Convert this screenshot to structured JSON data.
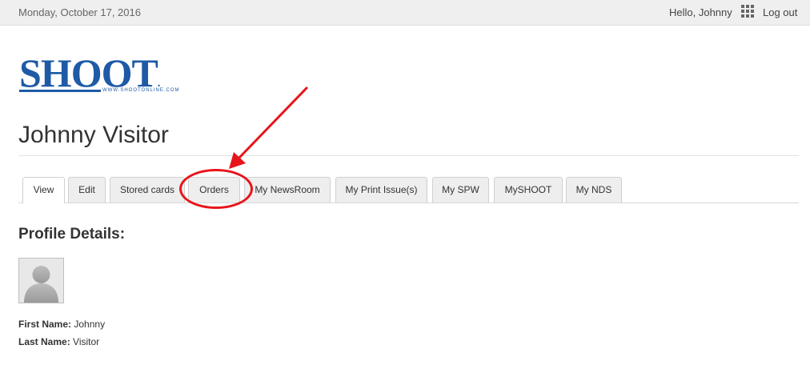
{
  "topbar": {
    "date": "Monday, October 17, 2016",
    "greeting": "Hello, Johnny",
    "apps_icon": "grid-icon",
    "logout_label": "Log out"
  },
  "logo": {
    "text": "SHOOT",
    "registered": ".",
    "url": "WWW.SHOOTONLINE.COM",
    "color": "#1e5aa6"
  },
  "page": {
    "title": "Johnny Visitor"
  },
  "tabs": [
    {
      "label": "View",
      "active": true
    },
    {
      "label": "Edit",
      "active": false
    },
    {
      "label": "Stored cards",
      "active": false
    },
    {
      "label": "Orders",
      "active": false
    },
    {
      "label": "My NewsRoom",
      "active": false
    },
    {
      "label": "My Print Issue(s)",
      "active": false
    },
    {
      "label": "My SPW",
      "active": false
    },
    {
      "label": "MySHOOT",
      "active": false
    },
    {
      "label": "My NDS",
      "active": false
    }
  ],
  "annotation": {
    "color": "#e8141b",
    "highlighted_tab": "Orders"
  },
  "profile": {
    "section_title": "Profile Details:",
    "avatar_icon": "avatar-placeholder-icon",
    "fields": [
      {
        "label": "First Name:",
        "value": "Johnny"
      },
      {
        "label": "Last Name:",
        "value": "Visitor"
      }
    ]
  }
}
